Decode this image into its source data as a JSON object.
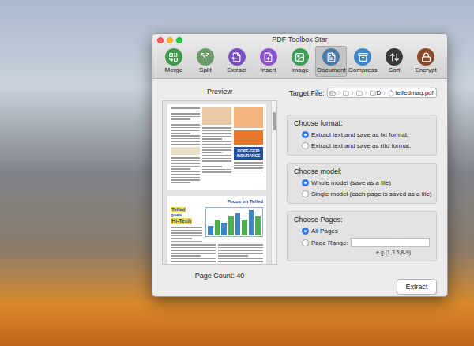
{
  "window": {
    "title": "PDF Toolbox Star"
  },
  "toolbar": [
    {
      "label": "Merge",
      "selected": false
    },
    {
      "label": "Split",
      "selected": false
    },
    {
      "label": "Extract",
      "selected": false
    },
    {
      "label": "Insert",
      "selected": false
    },
    {
      "label": "Image",
      "selected": false
    },
    {
      "label": "Document",
      "selected": true
    },
    {
      "label": "Compress",
      "selected": false
    },
    {
      "label": "Sort",
      "selected": false
    },
    {
      "label": "Encrypt",
      "selected": false
    }
  ],
  "preview": {
    "label": "Preview",
    "page_count": "Page Count: 40",
    "scrollbar": {
      "level": 0.12
    },
    "pages": [
      {
        "headings": [
          "POPE-GERI",
          "INSURANCE"
        ]
      },
      {
        "headings": [
          "Focus on Telfed",
          "Telfed",
          "goes",
          "Hi-Tech"
        ],
        "chart": {
          "values": [
            3,
            5,
            4,
            6,
            7,
            5,
            8,
            6
          ]
        }
      }
    ]
  },
  "target": {
    "label": "Target File:",
    "path": [
      {
        "kind": "disk",
        "label": ""
      },
      {
        "kind": "folder",
        "label": ""
      },
      {
        "kind": "folder",
        "label": ""
      },
      {
        "kind": "folder",
        "label": "D"
      },
      {
        "kind": "file",
        "label": "telfedmag.pdf"
      }
    ]
  },
  "groups": [
    {
      "title": "Choose format:",
      "options": [
        {
          "label": "Extract text and save as txt format.",
          "selected": true,
          "kind": "radio"
        },
        {
          "label": "Extract text and save as rtfd format.",
          "selected": false,
          "kind": "radio"
        }
      ]
    },
    {
      "title": "Choose model:",
      "options": [
        {
          "label": "Whole model (save as a file)",
          "selected": true,
          "kind": "radio"
        },
        {
          "label": "Single model (each page is saved as a file)",
          "selected": false,
          "kind": "radio"
        }
      ]
    },
    {
      "title": "Choose Pages:",
      "options": [
        {
          "label": "All Pages",
          "selected": true,
          "kind": "radio"
        },
        {
          "label": "Page Range:",
          "selected": false,
          "kind": "range",
          "value": "",
          "hint": "e.g.(1,3,5,8-9)"
        }
      ]
    }
  ],
  "buttons": [
    "Extract"
  ]
}
